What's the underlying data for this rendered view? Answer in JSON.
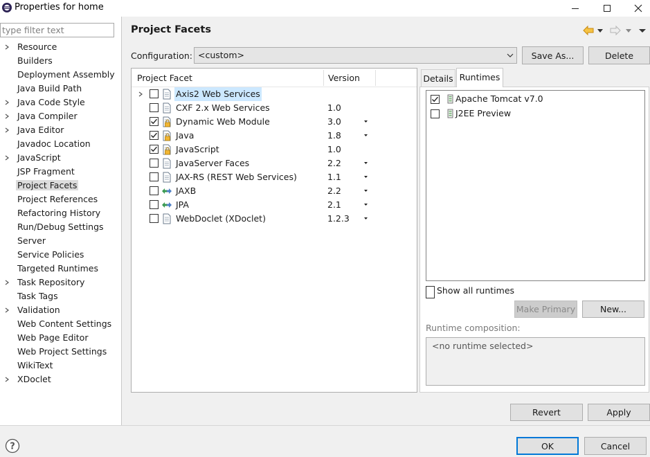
{
  "window": {
    "title": "Properties for home",
    "minimize_glyph": "—",
    "maximize_glyph": "☐",
    "close_glyph": "✕"
  },
  "sidebar": {
    "filter_placeholder": "type filter text",
    "items": [
      {
        "label": "Resource",
        "expandable": true
      },
      {
        "label": "Builders",
        "expandable": false
      },
      {
        "label": "Deployment Assembly",
        "expandable": false
      },
      {
        "label": "Java Build Path",
        "expandable": false
      },
      {
        "label": "Java Code Style",
        "expandable": true
      },
      {
        "label": "Java Compiler",
        "expandable": true
      },
      {
        "label": "Java Editor",
        "expandable": true
      },
      {
        "label": "Javadoc Location",
        "expandable": false
      },
      {
        "label": "JavaScript",
        "expandable": true
      },
      {
        "label": "JSP Fragment",
        "expandable": false
      },
      {
        "label": "Project Facets",
        "expandable": false,
        "selected": true
      },
      {
        "label": "Project References",
        "expandable": false
      },
      {
        "label": "Refactoring History",
        "expandable": false
      },
      {
        "label": "Run/Debug Settings",
        "expandable": false
      },
      {
        "label": "Server",
        "expandable": false
      },
      {
        "label": "Service Policies",
        "expandable": false
      },
      {
        "label": "Targeted Runtimes",
        "expandable": false
      },
      {
        "label": "Task Repository",
        "expandable": true
      },
      {
        "label": "Task Tags",
        "expandable": false
      },
      {
        "label": "Validation",
        "expandable": true
      },
      {
        "label": "Web Content Settings",
        "expandable": false
      },
      {
        "label": "Web Page Editor",
        "expandable": false
      },
      {
        "label": "Web Project Settings",
        "expandable": false
      },
      {
        "label": "WikiText",
        "expandable": false
      },
      {
        "label": "XDoclet",
        "expandable": true
      }
    ]
  },
  "page": {
    "title": "Project Facets",
    "configuration_label": "Configuration:",
    "configuration_value": "<custom>",
    "save_as_label": "Save As...",
    "delete_label": "Delete"
  },
  "facets": {
    "col_facet": "Project Facet",
    "col_version": "Version",
    "rows": [
      {
        "name": "Axis2 Web Services",
        "version": "",
        "checked": false,
        "expandable": true,
        "highlight": true,
        "has_dropdown": false,
        "icon": "document-icon"
      },
      {
        "name": "CXF 2.x Web Services",
        "version": "1.0",
        "checked": false,
        "expandable": false,
        "highlight": false,
        "has_dropdown": false,
        "icon": "document-icon"
      },
      {
        "name": "Dynamic Web Module",
        "version": "3.0",
        "checked": true,
        "expandable": false,
        "highlight": false,
        "has_dropdown": true,
        "icon": "locked-document-icon"
      },
      {
        "name": "Java",
        "version": "1.8",
        "checked": true,
        "expandable": false,
        "highlight": false,
        "has_dropdown": true,
        "icon": "locked-document-icon"
      },
      {
        "name": "JavaScript",
        "version": "1.0",
        "checked": true,
        "expandable": false,
        "highlight": false,
        "has_dropdown": false,
        "icon": "locked-document-icon"
      },
      {
        "name": "JavaServer Faces",
        "version": "2.2",
        "checked": false,
        "expandable": false,
        "highlight": false,
        "has_dropdown": true,
        "icon": "document-icon"
      },
      {
        "name": "JAX-RS (REST Web Services)",
        "version": "1.1",
        "checked": false,
        "expandable": false,
        "highlight": false,
        "has_dropdown": true,
        "icon": "document-icon"
      },
      {
        "name": "JAXB",
        "version": "2.2",
        "checked": false,
        "expandable": false,
        "highlight": false,
        "has_dropdown": true,
        "icon": "binding-arrows-icon"
      },
      {
        "name": "JPA",
        "version": "2.1",
        "checked": false,
        "expandable": false,
        "highlight": false,
        "has_dropdown": true,
        "icon": "binding-arrows-icon"
      },
      {
        "name": "WebDoclet (XDoclet)",
        "version": "1.2.3",
        "checked": false,
        "expandable": false,
        "highlight": false,
        "has_dropdown": true,
        "icon": "document-icon"
      }
    ]
  },
  "tabs": {
    "details_label": "Details",
    "runtimes_label": "Runtimes"
  },
  "runtimes": {
    "items": [
      {
        "name": "Apache Tomcat v7.0",
        "checked": true,
        "icon": "server-icon"
      },
      {
        "name": "J2EE Preview",
        "checked": false,
        "icon": "server-icon"
      }
    ],
    "show_all_label": "Show all runtimes",
    "make_primary_label": "Make Primary",
    "new_label": "New...",
    "composition_label": "Runtime composition:",
    "composition_value": "<no runtime selected>"
  },
  "footer": {
    "revert_label": "Revert",
    "apply_label": "Apply",
    "ok_label": "OK",
    "cancel_label": "Cancel"
  },
  "colors": {
    "selection_highlight": "#cce8ff",
    "sidebar_selected": "#dcdcdc",
    "default_button_border": "#0078d7",
    "back_arrow": "#e8a317"
  }
}
